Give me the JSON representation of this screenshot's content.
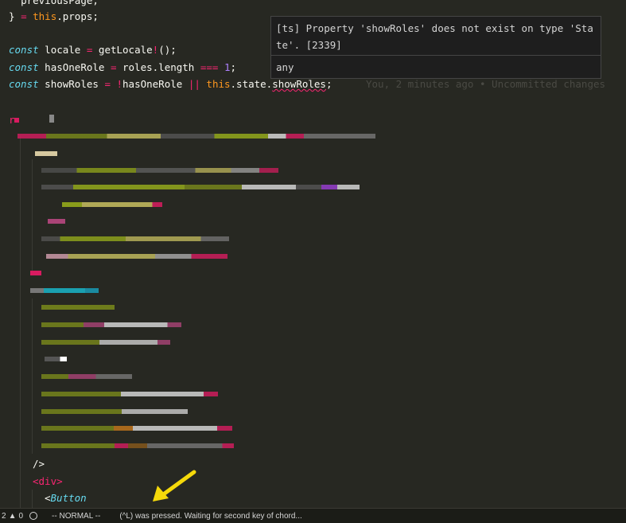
{
  "code": {
    "line0": "previousPage,",
    "line1_close": "} ",
    "line1_eq": "=",
    "line1_this": "this",
    "line1_rest": ".props;",
    "line_locale_kw": "const",
    "line_locale_name": " locale ",
    "line_locale_eq": "=",
    "line_locale_fn": " getLocale",
    "line_locale_bang": "!",
    "line_locale_end": "();",
    "line_role_kw": "const",
    "line_role_name": " hasOneRole ",
    "line_role_eq": "=",
    "line_role_mid": " roles.length ",
    "line_role_op": "===",
    "line_role_sp": " ",
    "line_role_num": "1",
    "line_role_end": ";",
    "line_show_kw": "const",
    "line_show_name": " showRoles ",
    "line_show_eq": "=",
    "line_show_sp": " ",
    "line_show_bang": "!",
    "line_show_mid": "hasOneRole ",
    "line_show_or": "||",
    "line_show_sp2": " ",
    "line_show_this": "this",
    "line_show_state": ".state.",
    "line_show_err": "showRoles",
    "line_show_end": ";",
    "blame": "You, 2 minutes ago • Uncommitted changes",
    "jsx_close": "/>",
    "jsx_div": "<div>",
    "jsx_button_lt": "<",
    "jsx_button": "Button",
    "return_partial": "r"
  },
  "tooltip": {
    "message": "[ts] Property 'showRoles' does not exist on type 'State'. [2339]",
    "type": "any"
  },
  "status": {
    "errors": "2",
    "warnings_icon": "warning-icon",
    "warnings": "0",
    "mode": "-- NORMAL --",
    "message": "(^L) was pressed. Waiting for second key of chord..."
  },
  "colors": {
    "background": "#272822",
    "keyword": "#66d9ef",
    "operator": "#f92672",
    "number": "#ae81ff",
    "this": "#fd971f",
    "arrow": "#f5d90a"
  }
}
